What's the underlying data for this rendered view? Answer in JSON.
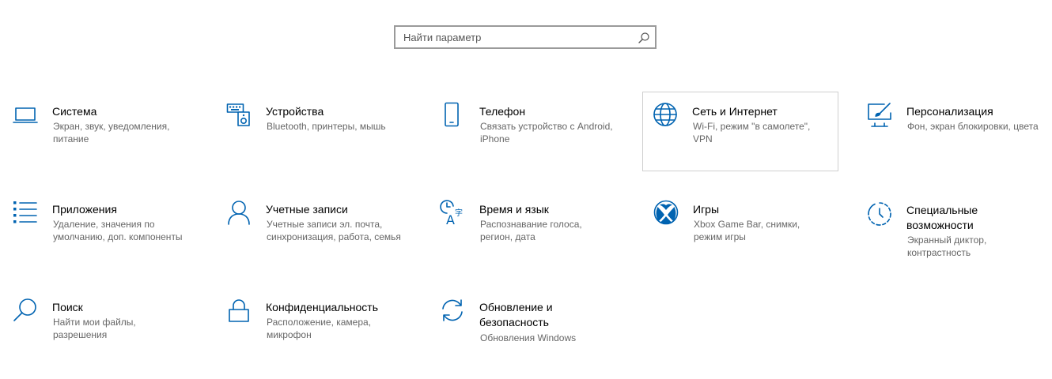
{
  "search": {
    "placeholder": "Найти параметр"
  },
  "tiles": [
    {
      "icon": "laptop-icon",
      "title": "Система",
      "desc": "Экран, звук, уведомления, питание"
    },
    {
      "icon": "keyboard-speaker-icon",
      "title": "Устройства",
      "desc": "Bluetooth, принтеры, мышь"
    },
    {
      "icon": "phone-icon",
      "title": "Телефон",
      "desc": "Связать устройство с Android, iPhone"
    },
    {
      "icon": "globe-icon",
      "title": "Сеть и Интернет",
      "desc": "Wi-Fi, режим \"в самолете\", VPN"
    },
    {
      "icon": "paintbrush-icon",
      "title": "Персонализация",
      "desc": "Фон, экран блокировки, цвета"
    },
    {
      "icon": "apps-list-icon",
      "title": "Приложения",
      "desc": "Удаление, значения по умолчанию, доп. компоненты"
    },
    {
      "icon": "person-icon",
      "title": "Учетные записи",
      "desc": "Учетные записи эл. почта, синхронизация, работа, семья"
    },
    {
      "icon": "time-language-icon",
      "title": "Время и язык",
      "desc": "Распознавание голоса, регион, дата"
    },
    {
      "icon": "xbox-icon",
      "title": "Игры",
      "desc": "Xbox Game Bar, снимки, режим игры"
    },
    {
      "icon": "ease-of-access-icon",
      "title": "Специальные возможности",
      "desc": "Экранный диктор, контрастность"
    },
    {
      "icon": "search-icon",
      "title": "Поиск",
      "desc": "Найти мои файлы, разрешения"
    },
    {
      "icon": "lock-icon",
      "title": "Конфиденциальность",
      "desc": "Расположение, камера, микрофон"
    },
    {
      "icon": "sync-icon",
      "title": "Обновление и безопасность",
      "desc": "Обновления Windows"
    }
  ]
}
